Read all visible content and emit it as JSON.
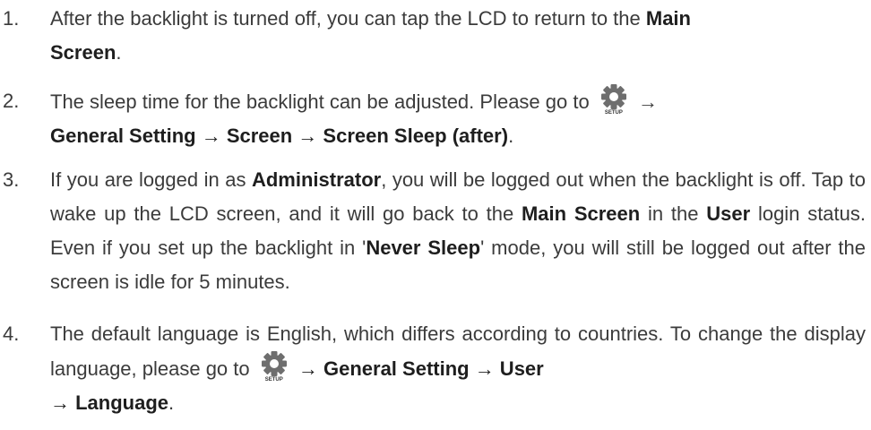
{
  "icon_label": "SETUP",
  "items": [
    {
      "number": "1.",
      "t1": "After the backlight is turned off, you can tap the LCD to return to the ",
      "b1": "Main",
      "line2_bold": "Screen",
      "t2": "."
    },
    {
      "number": "2.",
      "t1": "The sleep time for the backlight can be adjusted. Please go to",
      "arrow": "→",
      "b1": "General Setting → Screen → Screen Sleep (after)",
      "t2": "."
    },
    {
      "number": "3.",
      "t1": "If you are logged in as ",
      "b1": "Administrator",
      "t2": ", you will be logged out when the backlight is off. Tap to wake up the LCD screen, and it will go back to the ",
      "b2": "Main Screen",
      "t3": " in the ",
      "b3": "User",
      "t4": " login status. Even if you set up the backlight in '",
      "b4": "Never Sleep",
      "t5": "' mode, you will still be logged out after the screen is idle for 5 minutes."
    },
    {
      "number": "4.",
      "t1": "The default language is English, which differs according to countries. To change the display language, please go to ",
      "b1": "→ General Setting → User",
      "b2": "→ Language",
      "t2": "."
    }
  ]
}
